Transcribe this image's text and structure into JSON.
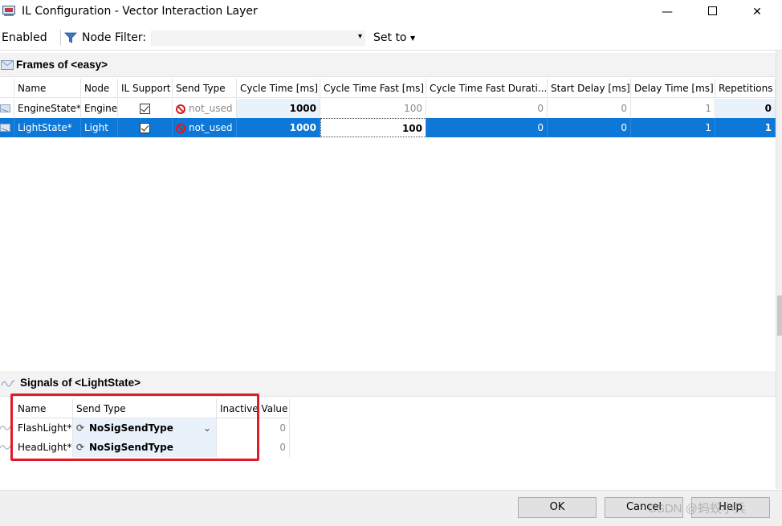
{
  "window": {
    "title": "IL Configuration - Vector Interaction Layer",
    "minimize": "—",
    "close": "✕"
  },
  "toolbar": {
    "enabled_label": "Enabled",
    "node_filter_label": "Node Filter:",
    "node_filter_value": "",
    "set_to_label": "Set to"
  },
  "frames": {
    "title": "Frames of <easy>",
    "columns": [
      "Name",
      "Node",
      "IL Support",
      "Send Type",
      "Cycle Time [ms]",
      "Cycle Time Fast [ms]",
      "Cycle Time Fast Durati...",
      "Start Delay [ms]",
      "Delay Time [ms]",
      "Repetitions"
    ],
    "rows": [
      {
        "name": "EngineState*",
        "node": "Engine",
        "il_support": true,
        "send_type": "not_used",
        "cycle_time": "1000",
        "cycle_time_fast": "100",
        "cycle_time_fast_duration": "0",
        "start_delay": "0",
        "delay_time": "1",
        "repetitions": "0"
      },
      {
        "name": "LightState*",
        "node": "Light",
        "il_support": true,
        "send_type": "not_used",
        "cycle_time": "1000",
        "cycle_time_fast": "100",
        "cycle_time_fast_duration": "0",
        "start_delay": "0",
        "delay_time": "1",
        "repetitions": "1"
      }
    ]
  },
  "signals": {
    "title": "Signals of <LightState>",
    "columns": [
      "Name",
      "Send Type",
      "Inactive Value"
    ],
    "rows": [
      {
        "name": "FlashLight*",
        "send_type": "NoSigSendType",
        "inactive_value": "0"
      },
      {
        "name": "HeadLight*",
        "send_type": "NoSigSendType",
        "inactive_value": "0"
      }
    ]
  },
  "buttons": {
    "ok": "OK",
    "cancel": "Cancel",
    "help": "Help"
  },
  "watermark": "CSDN @蚂蚁小兵",
  "colors": {
    "selection": "#0d78d7",
    "highlight_box": "#e21b2b",
    "error_icon": "#d02020"
  }
}
